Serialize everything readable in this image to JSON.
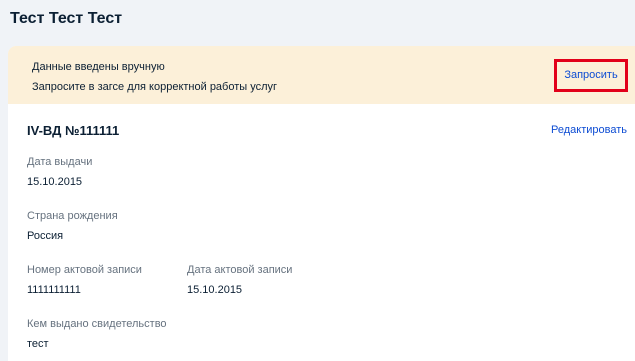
{
  "page": {
    "title": "Тест Тест Тест"
  },
  "notice": {
    "line1": "Данные введены вручную",
    "line2": "Запросите в загсе для корректной работы услуг",
    "button_label": "Запросить"
  },
  "document": {
    "title": "IV-ВД №111111",
    "edit_label": "Редактировать",
    "fields": {
      "issue_date": {
        "label": "Дата выдачи",
        "value": "15.10.2015"
      },
      "birth_country": {
        "label": "Страна рождения",
        "value": "Россия"
      },
      "record_number": {
        "label": "Номер актовой записи",
        "value": "1111111111"
      },
      "record_date": {
        "label": "Дата актовой записи",
        "value": "15.10.2015"
      },
      "issued_by": {
        "label": "Кем выдано свидетельство",
        "value": "тест"
      }
    }
  },
  "colors": {
    "accent": "#0d4cd3",
    "notice_background": "#fcf0d9",
    "highlight_border": "#e2001a",
    "label_text": "#66727f"
  }
}
